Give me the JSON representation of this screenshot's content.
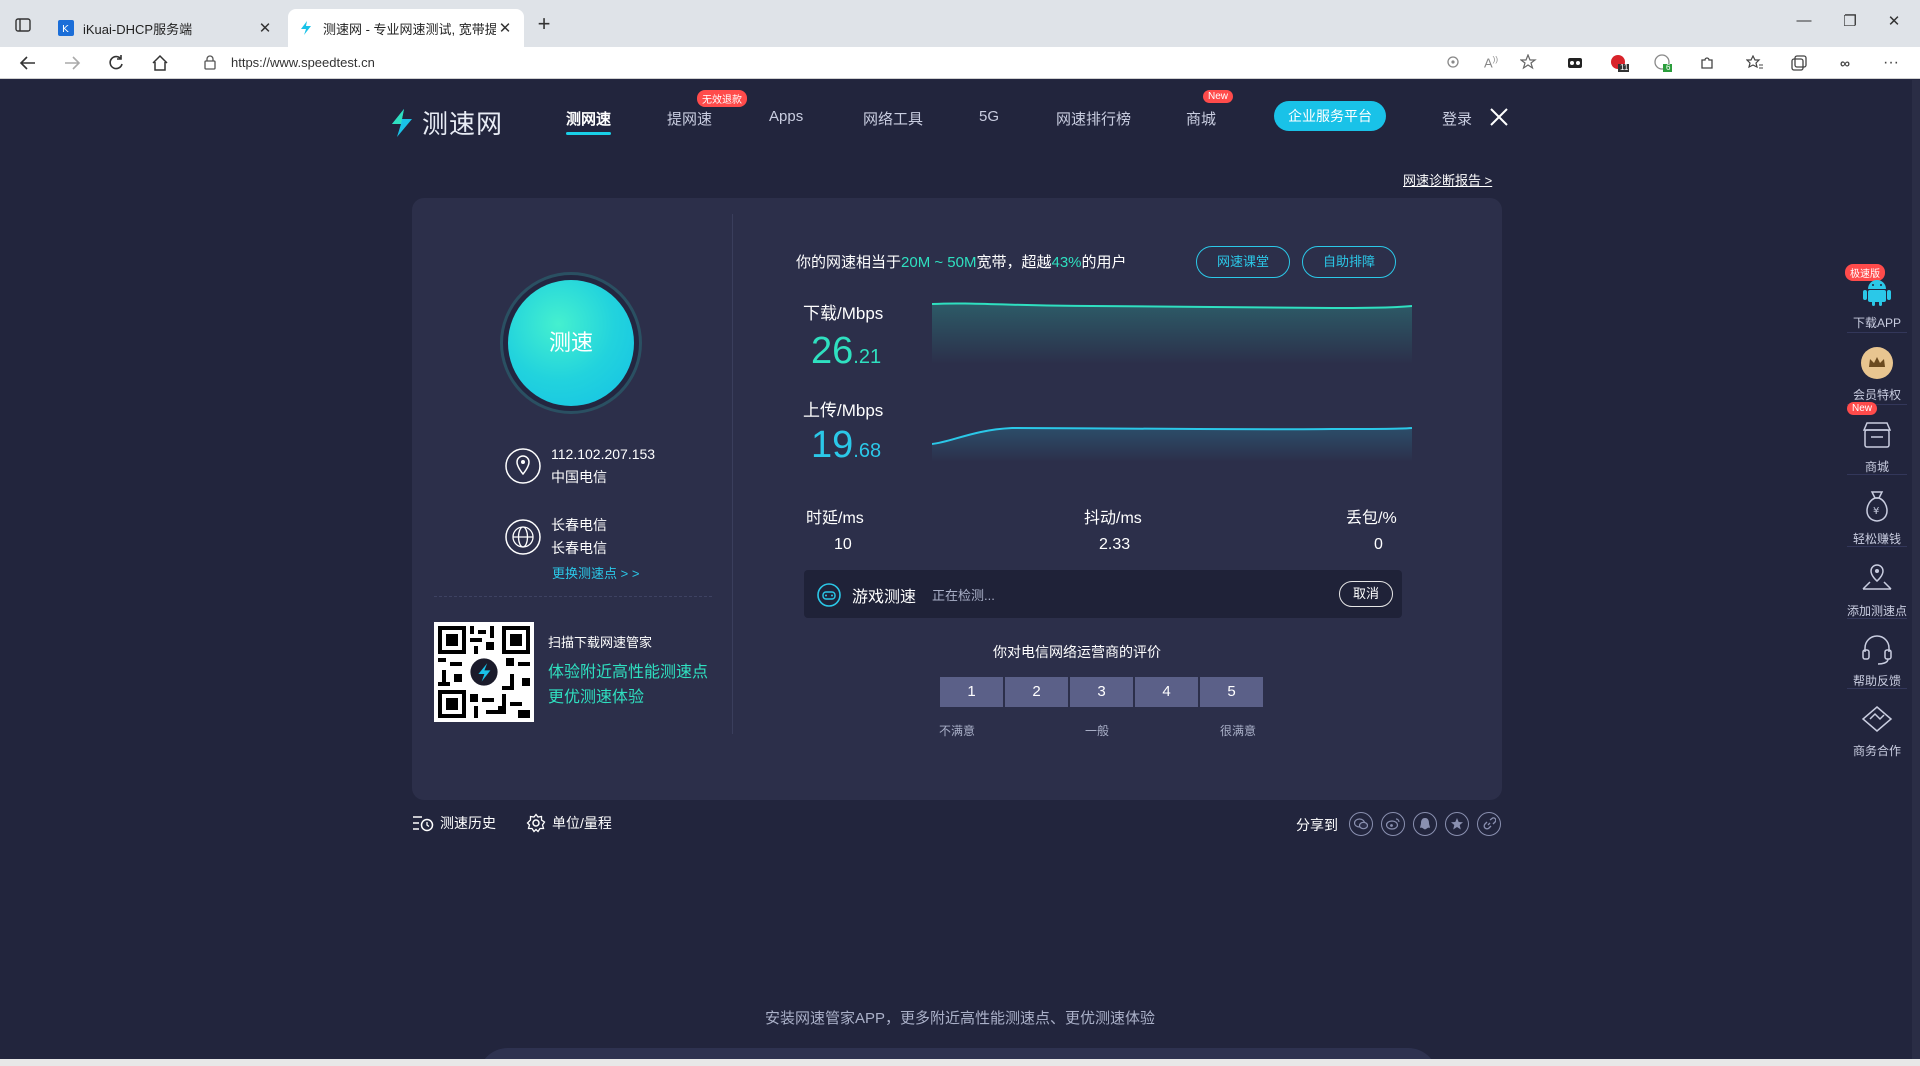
{
  "browser": {
    "tabs": [
      {
        "title": "iKuai-DHCP服务端",
        "active": false,
        "favicon": "ikuai-icon"
      },
      {
        "title": "测速网 - 专业网速测试, 宽带提速",
        "active": true,
        "favicon": "speedtest-icon"
      }
    ],
    "url": "https://www.speedtest.cn",
    "toolbar_badges": {
      "ext_red": "11",
      "ext_green": "6"
    }
  },
  "site": {
    "logo_text": "测速网",
    "nav": [
      {
        "label": "测网速",
        "active": true
      },
      {
        "label": "提网速",
        "badge": "无效退款"
      },
      {
        "label": "Apps"
      },
      {
        "label": "网络工具"
      },
      {
        "label": "5G"
      },
      {
        "label": "网速排行榜"
      },
      {
        "label": "商城",
        "badge": "New"
      }
    ],
    "enterprise_button": "企业服务平台",
    "login": "登录",
    "diagnosis_link": "网速诊断报告 >"
  },
  "left_panel": {
    "start_button": "测速",
    "ip": "112.102.207.153",
    "isp": "中国电信",
    "node_name_1": "长春电信",
    "node_name_2": "长春电信",
    "change_node": "更换测速点 > >",
    "qr_title": "扫描下载网速管家",
    "qr_line1": "体验附近高性能测速点",
    "qr_line2": "更优测速体验"
  },
  "result": {
    "summary_prefix": "你的网速相当于",
    "summary_range": "20M ~ 50M",
    "summary_mid": "宽带，超越",
    "summary_percent": "43%",
    "summary_suffix": "的用户",
    "btn_class": "网速课堂",
    "btn_troubleshoot": "自助排障",
    "download_label": "下载/Mbps",
    "download_int": "26",
    "download_dec": ".21",
    "upload_label": "上传/Mbps",
    "upload_int": "19",
    "upload_dec": ".68",
    "latency_label": "时延/ms",
    "latency_value": "10",
    "jitter_label": "抖动/ms",
    "jitter_value": "2.33",
    "loss_label": "丢包/%",
    "loss_value": "0",
    "game_title": "游戏测速",
    "game_status": "正在检测...",
    "cancel": "取消",
    "rating_title": "你对电信网络运营商的评价",
    "rating_options": [
      "1",
      "2",
      "3",
      "4",
      "5"
    ],
    "rating_low": "不满意",
    "rating_mid": "一般",
    "rating_high": "很满意"
  },
  "footer": {
    "history": "测速历史",
    "unit": "单位/量程",
    "share_label": "分享到",
    "share_icons": [
      "wechat-icon",
      "weibo-icon",
      "qq-icon",
      "star-icon",
      "link-icon"
    ],
    "bottom_text": "安装网速管家APP，更多附近高性能测速点、更优测速体验"
  },
  "right_bar": [
    {
      "label": "下载APP",
      "icon": "android-icon",
      "badge": "极速版"
    },
    {
      "label": "会员特权",
      "icon": "crown-icon"
    },
    {
      "label": "商城",
      "icon": "shop-icon",
      "badge": "New"
    },
    {
      "label": "轻松赚钱",
      "icon": "money-bag-icon"
    },
    {
      "label": "添加测速点",
      "icon": "add-node-icon"
    },
    {
      "label": "帮助反馈",
      "icon": "headset-icon"
    },
    {
      "label": "商务合作",
      "icon": "handshake-icon"
    }
  ],
  "colors": {
    "page_bg": "#22253d",
    "card_bg": "#2c2f4a",
    "accent_green": "#2fe0c0",
    "accent_cyan": "#2bc8e8",
    "badge_red": "#ff4b4b"
  }
}
